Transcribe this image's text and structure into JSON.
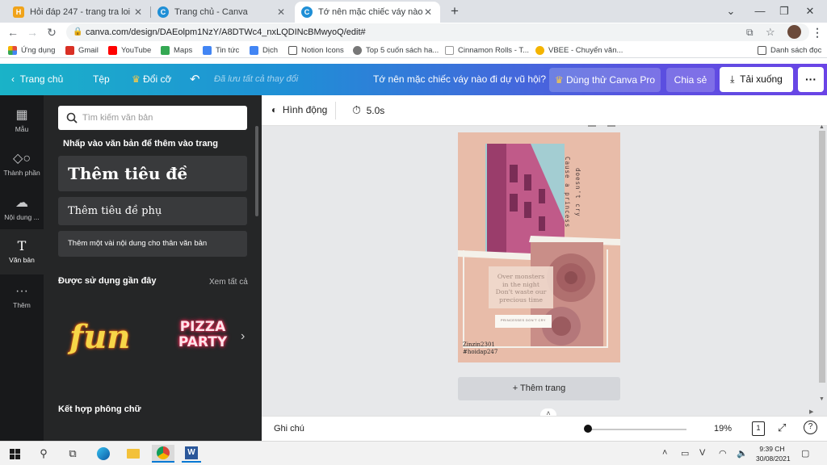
{
  "browser": {
    "tabs": [
      {
        "title": "Hỏi đáp 247 - trang tra loi",
        "favicon_color": "#f0a31a",
        "favicon_letter": "H"
      },
      {
        "title": "Trang chủ - Canva",
        "favicon_color": "#1f8fd6",
        "favicon_letter": "C"
      },
      {
        "title": "Tớ nên mặc chiếc váy nào đi dự vũ",
        "favicon_color": "#1f8fd6",
        "favicon_letter": "C"
      }
    ],
    "url": "canva.com/design/DAEolpm1NzY/A8DTWc4_nxLQDINcBMwyoQ/edit#",
    "bookmarks": [
      {
        "label": "Ứng dụng",
        "color": "#e34a3a"
      },
      {
        "label": "Gmail",
        "color": "#d93025"
      },
      {
        "label": "YouTube",
        "color": "#ff0000"
      },
      {
        "label": "Maps",
        "color": "#34a853"
      },
      {
        "label": "Tin tức",
        "color": "#4285f4"
      },
      {
        "label": "Dịch",
        "color": "#4285f4"
      },
      {
        "label": "Notion Icons",
        "color": "#555555"
      },
      {
        "label": "Top 5 cuốn sách ha...",
        "color": "#777777"
      },
      {
        "label": "Cinnamon Rolls - T...",
        "color": "#999999"
      },
      {
        "label": "VBEE - Chuyển văn...",
        "color": "#f4b400"
      }
    ],
    "reading_list": "Danh sách đọc"
  },
  "header": {
    "home": "Trang chủ",
    "file": "Tệp",
    "resize": "Đổi cỡ",
    "saved": "Đã lưu tất cả thay đổi",
    "design_title": "Tớ nên mặc chiếc váy nào đi dự vũ hội?",
    "try_pro": "Dùng thử Canva Pro",
    "share": "Chia sẻ",
    "download": "Tải xuống"
  },
  "rail": [
    {
      "label": "Mẫu",
      "icon": "template-icon"
    },
    {
      "label": "Thành phần",
      "icon": "elements-icon"
    },
    {
      "label": "Nội dung ...",
      "icon": "upload-icon"
    },
    {
      "label": "Văn bản",
      "icon": "text-icon"
    },
    {
      "label": "Thêm",
      "icon": "more-icon"
    }
  ],
  "panel": {
    "search_placeholder": "Tìm kiếm văn bản",
    "click_hint": "Nhấp vào văn bản để thêm vào trang",
    "add_heading": "Thêm tiêu đề",
    "add_subheading": "Thêm tiêu đề phụ",
    "add_body": "Thêm một vài nội dung cho thân văn bản",
    "recent_title": "Được sử dụng gần đây",
    "see_all": "Xem tất cả",
    "recent_fonts": [
      "fun",
      "PIZZA",
      "PARTY"
    ],
    "font_combos": "Kết hợp phông chữ"
  },
  "toolbar": {
    "animate": "Hình động",
    "duration": "5.0s"
  },
  "poster": {
    "vertical_text_1": "Cause a princess",
    "vertical_text_2": "doesn't cry",
    "quote_lines": [
      "Over monsters",
      "in the night",
      "Don't waste our",
      "precious time"
    ],
    "badge": "PRINCESSES DON'T CRY",
    "credit_1": "Zinzin2301",
    "credit_2": "#hoidap247"
  },
  "add_page": "+ Thêm trang",
  "footer": {
    "notes": "Ghi chú",
    "zoom": "19%",
    "zoom_fraction": 0.19,
    "page_num": "1"
  },
  "taskbar": {
    "time": "9:39 CH",
    "date": "30/08/2021"
  }
}
